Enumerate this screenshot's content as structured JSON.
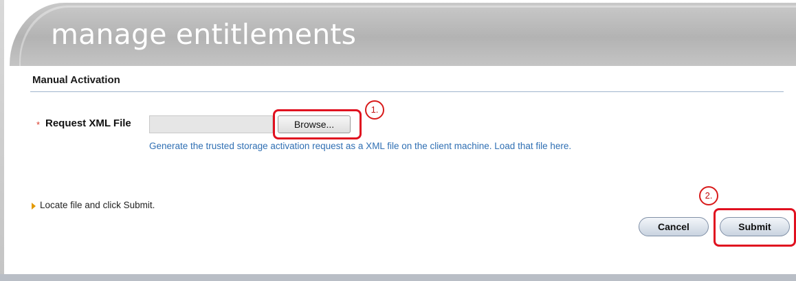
{
  "header": {
    "title": "manage entitlements"
  },
  "section": {
    "heading": "Manual Activation"
  },
  "form": {
    "required_marker": "*",
    "field_label": "Request XML File",
    "file_value": "",
    "browse_label": "Browse...",
    "help_text": "Generate the trusted storage activation request as a XML file on the client machine. Load that file here."
  },
  "hint": {
    "text": "Locate file and click Submit."
  },
  "buttons": {
    "cancel_label": "Cancel",
    "submit_label": "Submit"
  },
  "annotations": {
    "step_1": "1.",
    "step_2": "2."
  },
  "colors": {
    "annotation_red": "#e0101f",
    "link_blue": "#2f6fb3",
    "header_gray": "#b3b3b3"
  }
}
